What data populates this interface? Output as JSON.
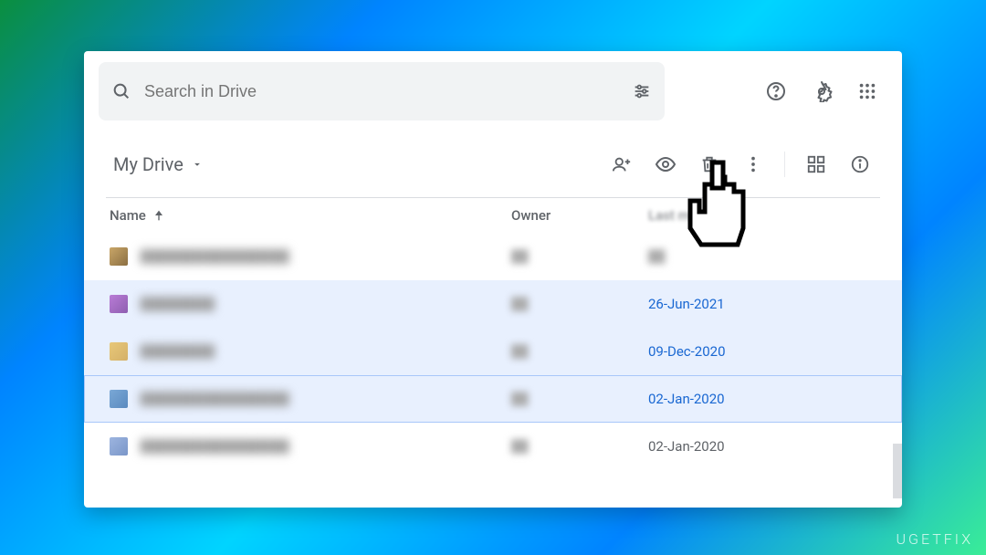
{
  "search": {
    "placeholder": "Search in Drive"
  },
  "breadcrumb": {
    "label": "My Drive"
  },
  "columns": {
    "name": "Name",
    "owner": "Owner",
    "modified": "Last modified"
  },
  "files": [
    {
      "name": "████████████████",
      "owner": "██",
      "modified": "██",
      "selected": false,
      "focused": false
    },
    {
      "name": "████████",
      "owner": "██",
      "modified": "26-Jun-2021",
      "selected": true,
      "focused": false
    },
    {
      "name": "████████",
      "owner": "██",
      "modified": "09-Dec-2020",
      "selected": true,
      "focused": false
    },
    {
      "name": "████████████████",
      "owner": "██",
      "modified": "02-Jan-2020",
      "selected": true,
      "focused": true
    },
    {
      "name": "████████████████",
      "owner": "██",
      "modified": "02-Jan-2020",
      "selected": false,
      "focused": false
    }
  ],
  "watermark": "UGETFIX"
}
